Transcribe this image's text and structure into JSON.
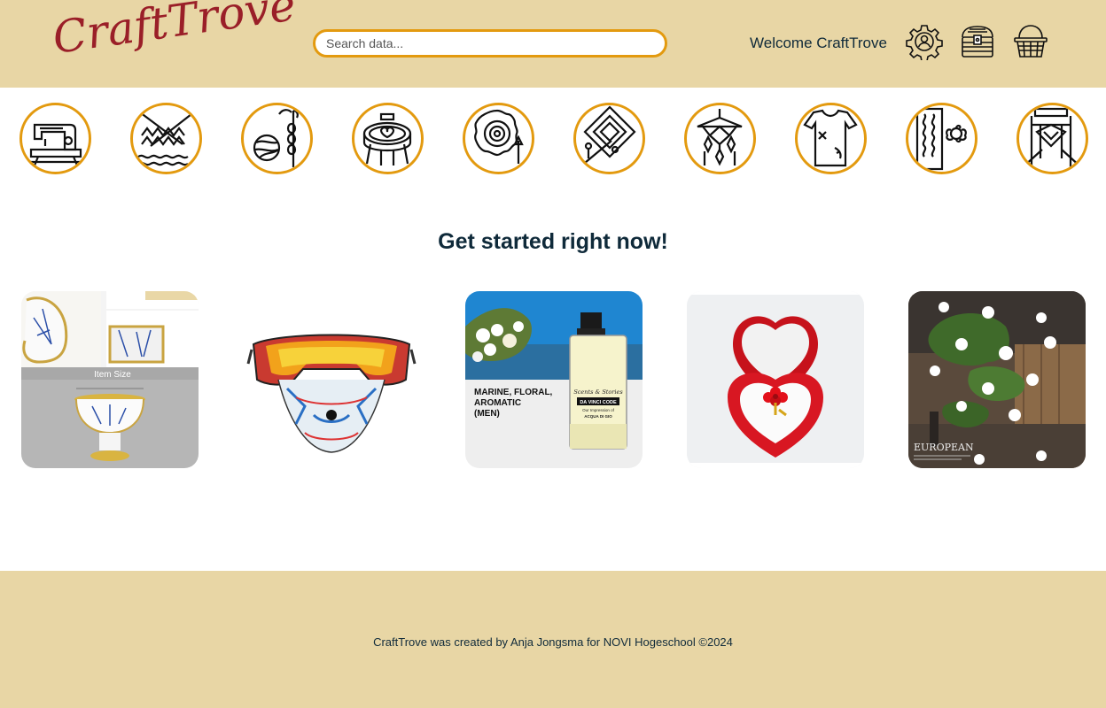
{
  "header": {
    "logo": "CraftTrove",
    "search_placeholder": "Search data...",
    "welcome": "Welcome CraftTrove",
    "icons": [
      "user-settings-icon",
      "treasure-chest-icon",
      "basket-icon"
    ]
  },
  "categories": [
    {
      "icon": "sewing-machine-icon"
    },
    {
      "icon": "knitting-icon"
    },
    {
      "icon": "yarn-crochet-icon"
    },
    {
      "icon": "embroidery-hoop-icon"
    },
    {
      "icon": "pottery-icon"
    },
    {
      "icon": "quilting-icon"
    },
    {
      "icon": "macrame-icon"
    },
    {
      "icon": "upcycling-clothes-icon"
    },
    {
      "icon": "fabric-printing-icon"
    },
    {
      "icon": "weaving-icon"
    }
  ],
  "main": {
    "title": "Get started right now!",
    "products": [
      {
        "name": "vase-image",
        "caption": "Item Size"
      },
      {
        "name": "goggles-mask-image"
      },
      {
        "name": "perfume-image",
        "text": [
          "MARINE, FLORAL,",
          "AROMATIC",
          "(MEN)"
        ],
        "brand": "Scents & Stories",
        "label": "DA VINCI CODE",
        "sub": "Our Impression of",
        "sub2": "ACQUA DI GIO"
      },
      {
        "name": "ring-box-image"
      },
      {
        "name": "plant-lamp-image",
        "caption": "EUROPEAN"
      }
    ]
  },
  "footer": {
    "text": "CraftTrove was created by Anja Jongsma for NOVI Hogeschool ©2024"
  },
  "colors": {
    "header_bg": "#e8d6a5",
    "accent": "#e39a0f",
    "logo": "#9a1f28",
    "text": "#0f2a3a"
  }
}
